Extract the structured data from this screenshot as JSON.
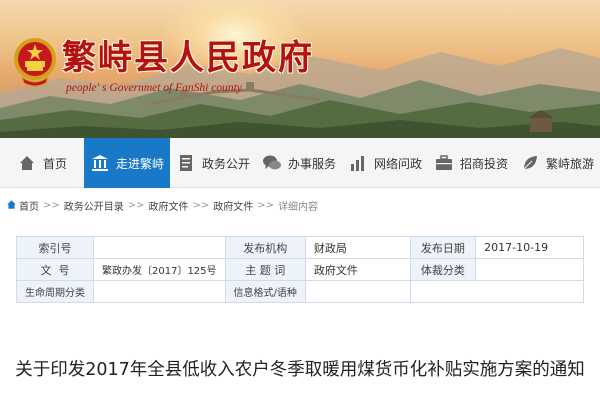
{
  "header": {
    "title": "繁峙县人民政府",
    "subtitle": "people' s Governmet of FanShi county",
    "emblem_icon": "national-emblem-icon"
  },
  "nav": {
    "items": [
      {
        "label": "首页",
        "icon": "home-icon"
      },
      {
        "label": "走进繁峙",
        "icon": "building-icon",
        "active": true
      },
      {
        "label": "政务公开",
        "icon": "document-icon"
      },
      {
        "label": "办事服务",
        "icon": "chat-icon"
      },
      {
        "label": "网络问政",
        "icon": "chart-icon"
      },
      {
        "label": "招商投资",
        "icon": "briefcase-icon"
      },
      {
        "label": "繁峙旅游",
        "icon": "leaf-icon"
      }
    ],
    "active_color": "#1a78c8"
  },
  "breadcrumb": {
    "items": [
      "首页",
      "政务公开目录",
      "政府文件",
      "政府文件"
    ],
    "current": "详细内容",
    "separator": ">>"
  },
  "meta": {
    "index_label": "索引号",
    "index_value": "",
    "org_label": "发布机构",
    "org_value": "财政局",
    "date_label": "发布日期",
    "date_value": "2017-10-19",
    "doc_label": "文  号",
    "doc_value": "繁政办发〔2017〕125号",
    "topic_label": "主 题 词",
    "topic_value": "政府文件",
    "genre_label": "体裁分类",
    "genre_value": "",
    "life_label": "生命周期分类",
    "life_value": "",
    "format_label": "信息格式/语种",
    "format_value": ""
  },
  "article": {
    "title": "关于印发2017年全县低收入农户冬季取暖用煤货币化补贴实施方案的通知"
  },
  "colors": {
    "title_red": "#b31212",
    "label_bg": "#eef3fa",
    "border": "#d0dced"
  }
}
